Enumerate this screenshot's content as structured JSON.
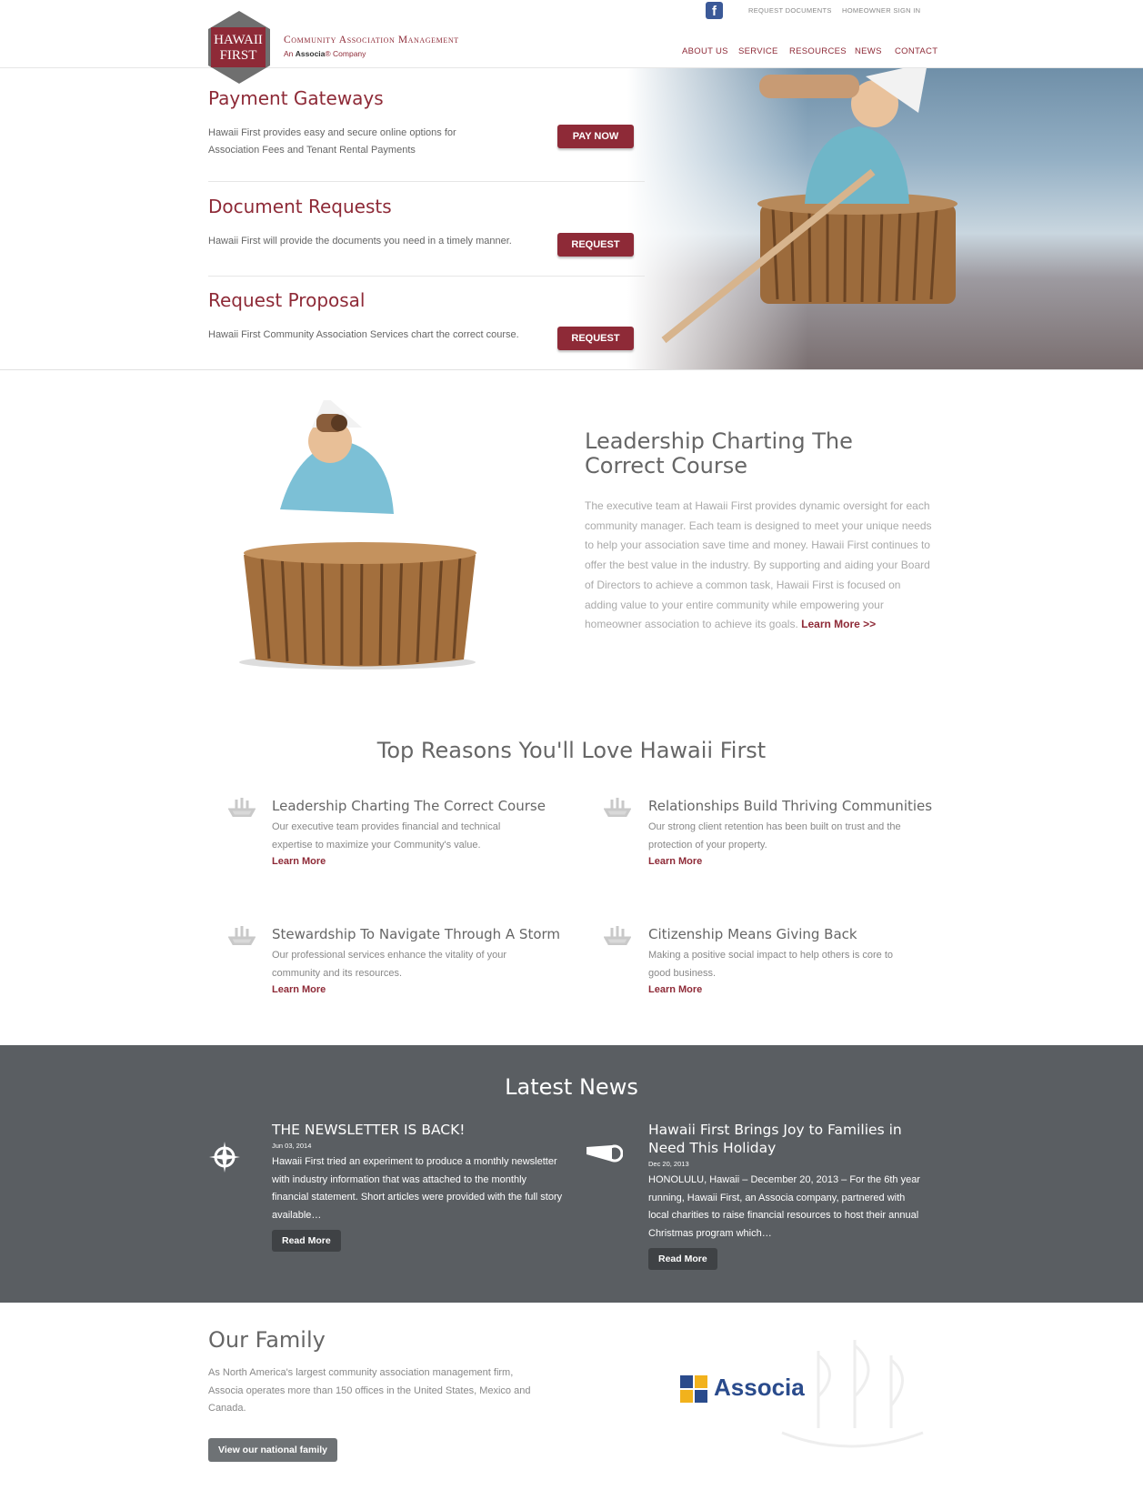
{
  "header": {
    "logo": {
      "line1": "HAWAII",
      "line2": "FIRST",
      "tagline": "Community Association Management",
      "sub_prefix": "An",
      "sub_brand": "Associa",
      "sub_suffix": "® Company"
    },
    "top_links": [
      "REQUEST DOCUMENTS",
      "HOMEOWNER SIGN IN"
    ],
    "nav": [
      "ABOUT US",
      "SERVICE",
      "RESOURCES",
      "NEWS",
      "CONTACT"
    ]
  },
  "hero": {
    "items": [
      {
        "title": "Payment Gateways",
        "text": "Hawaii First provides easy and secure online options for Association Fees and Tenant Rental Payments",
        "button": "PAY NOW"
      },
      {
        "title": "Document Requests",
        "text": "Hawaii First will provide the documents you need in a timely manner.",
        "button": "REQUEST"
      },
      {
        "title": "Request Proposal",
        "text": "Hawaii First Community Association Services chart the correct course.",
        "button": "REQUEST"
      }
    ]
  },
  "leadership": {
    "title": "Leadership Charting The Correct Course",
    "body": "The executive team at Hawaii First provides dynamic oversight for each community manager. Each team is designed to meet your unique needs to help your association save time and money. Hawaii First continues to offer the best value in the industry. By supporting and aiding your Board of Directors to achieve a common task, Hawaii First is focused on adding value to your entire community while empowering your homeowner association to achieve its goals.",
    "link": "Learn More >>"
  },
  "reasons": {
    "title": "Top Reasons You'll Love Hawaii First",
    "items": [
      {
        "title": "Leadership Charting The Correct Course",
        "text": "Our executive team provides financial and technical expertise to maximize your Community's value.",
        "link": "Learn More"
      },
      {
        "title": "Relationships Build Thriving Communities",
        "text": "Our strong client retention has been built on trust and the protection of your property.",
        "link": "Learn More"
      },
      {
        "title": "Stewardship To Navigate Through A Storm",
        "text": "Our professional services enhance the vitality of your community and its resources.",
        "link": "Learn More"
      },
      {
        "title": "Citizenship Means Giving Back",
        "text": "Making a positive social impact to help others is core to good business.",
        "link": "Learn More"
      }
    ]
  },
  "news": {
    "title": "Latest News",
    "items": [
      {
        "title": "THE NEWSLETTER IS BACK!",
        "date": "Jun 03, 2014",
        "text": "Hawaii First tried an experiment to produce a monthly newsletter with industry information that was attached to the monthly financial statement. Short articles were provided with the full story available…",
        "button": "Read More"
      },
      {
        "title": "Hawaii First Brings Joy to Families in Need This Holiday",
        "date": "Dec 20, 2013",
        "text": "HONOLULU, Hawaii – December 20, 2013 – For the 6th year running, Hawaii First, an Associa company, partnered with local charities to raise financial resources to host their annual Christmas program which…",
        "button": "Read More"
      }
    ]
  },
  "family": {
    "title": "Our Family",
    "text": "As North America's largest community association management firm, Associa operates more than 150 offices in the United States, Mexico and Canada.",
    "button": "View our national family",
    "logo": "Associa"
  },
  "colors": {
    "brand": "#8e2a37",
    "news_bg": "#5a5e62"
  }
}
